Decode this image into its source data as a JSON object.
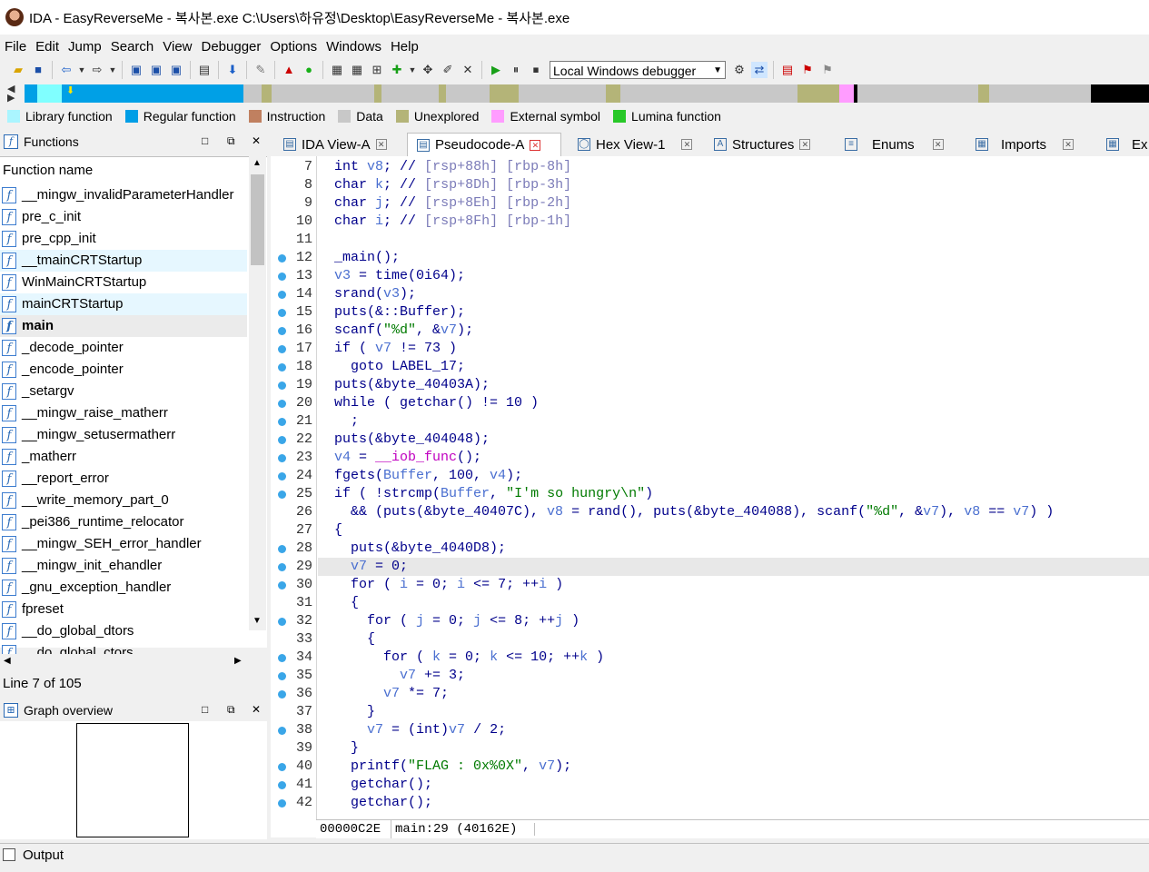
{
  "window": {
    "title": "IDA - EasyReverseMe - 복사본.exe C:\\Users\\하유정\\Desktop\\EasyReverseMe - 복사본.exe"
  },
  "menu": [
    "File",
    "Edit",
    "Jump",
    "Search",
    "View",
    "Debugger",
    "Options",
    "Windows",
    "Help"
  ],
  "toolbar": {
    "debugger_select": "Local Windows debugger",
    "icons": [
      "open-icon",
      "save-icon",
      "back-icon",
      "dropdown-icon",
      "forward-icon",
      "dropdown-icon",
      "search-text-icon",
      "search-binary-icon",
      "search-immediate-icon",
      "search-next-icon",
      "jump-icon",
      "break-icon",
      "warning-icon",
      "run-icon",
      "graph-icon",
      "graph2-icon",
      "node-icon",
      "add-node-icon",
      "dropdown-icon",
      "tree-icon",
      "edit-icon",
      "close-icon",
      "play-icon",
      "pause-icon",
      "stop-icon"
    ]
  },
  "navband": {
    "colors": {
      "library": "#80ffff",
      "regular": "#00a0e6",
      "instruction": "#c08060",
      "data": "#c8c8c8",
      "unexplored": "#b4b478",
      "external": "#ff9cff",
      "lumina": "#00c800",
      "black": "#000000"
    }
  },
  "legend": [
    {
      "label": "Library function",
      "color": "#aaf5ff"
    },
    {
      "label": "Regular function",
      "color": "#009ee6"
    },
    {
      "label": "Instruction",
      "color": "#c08060"
    },
    {
      "label": "Data",
      "color": "#c8c8c8"
    },
    {
      "label": "Unexplored",
      "color": "#b4b478"
    },
    {
      "label": "External symbol",
      "color": "#ff9cff"
    },
    {
      "label": "Lumina function",
      "color": "#28c828"
    }
  ],
  "functions": {
    "title": "Functions",
    "column_header": "Function name",
    "items": [
      "__mingw_invalidParameterHandler",
      "pre_c_init",
      "pre_cpp_init",
      "__tmainCRTStartup",
      "WinMainCRTStartup",
      "mainCRTStartup",
      "main",
      "_decode_pointer",
      "_encode_pointer",
      "_setargv",
      "__mingw_raise_matherr",
      "__mingw_setusermatherr",
      "_matherr",
      "__report_error",
      "__write_memory_part_0",
      "_pei386_runtime_relocator",
      "__mingw_SEH_error_handler",
      "__mingw_init_ehandler",
      "_gnu_exception_handler",
      "fpreset",
      "__do_global_dtors",
      "__do_global_ctors"
    ],
    "line_info": "Line 7 of 105"
  },
  "graph_overview": {
    "title": "Graph overview"
  },
  "tabs": [
    {
      "label": "IDA View-A"
    },
    {
      "label": "Pseudocode-A"
    },
    {
      "label": "Hex View-1"
    },
    {
      "label": "Structures"
    },
    {
      "label": "Enums"
    },
    {
      "label": "Imports"
    },
    {
      "label": "Ex"
    }
  ],
  "code": {
    "line_numbers": [
      "7",
      "8",
      "9",
      "10",
      "11",
      "12",
      "13",
      "14",
      "15",
      "16",
      "17",
      "18",
      "19",
      "20",
      "21",
      "22",
      "23",
      "24",
      "25",
      "26",
      "27",
      "28",
      "29",
      "30",
      "31",
      "32",
      "33",
      "34",
      "35",
      "36",
      "37",
      "38",
      "39",
      "40",
      "41",
      "42"
    ],
    "lines": [
      "int v8; // [rsp+88h] [rbp-8h]",
      "char k; // [rsp+8Dh] [rbp-3h]",
      "char j; // [rsp+8Eh] [rbp-2h]",
      "char i; // [rsp+8Fh] [rbp-1h]",
      "",
      "_main();",
      "v3 = time(0i64);",
      "srand(v3);",
      "puts(&::Buffer);",
      "scanf(\"%d\", &v7);",
      "if ( v7 != 73 )",
      "  goto LABEL_17;",
      "puts(&byte_40403A);",
      "while ( getchar() != 10 )",
      "  ;",
      "puts(&byte_404048);",
      "v4 = __iob_func();",
      "fgets(Buffer, 100, v4);",
      "if ( !strcmp(Buffer, \"I'm so hungry\\n\")",
      "  && (puts(&byte_40407C), v8 = rand(), puts(&byte_404088), scanf(\"%d\", &v7), v8 == v7) )",
      "{",
      "  puts(&byte_4040D8);",
      "  v7 = 0;",
      "  for ( i = 0; i <= 7; ++i )",
      "  {",
      "    for ( j = 0; j <= 8; ++j )",
      "    {",
      "      for ( k = 0; k <= 10; ++k )",
      "        v7 += 3;",
      "      v7 *= 7;",
      "    }",
      "    v7 = (int)v7 / 2;",
      "  }",
      "  printf(\"FLAG : 0x%0X\", v7);",
      "  getchar();",
      "  getchar();"
    ]
  },
  "status": {
    "address": "00000C2E",
    "location": "main:29 (40162E)"
  },
  "output": {
    "title": "Output"
  }
}
